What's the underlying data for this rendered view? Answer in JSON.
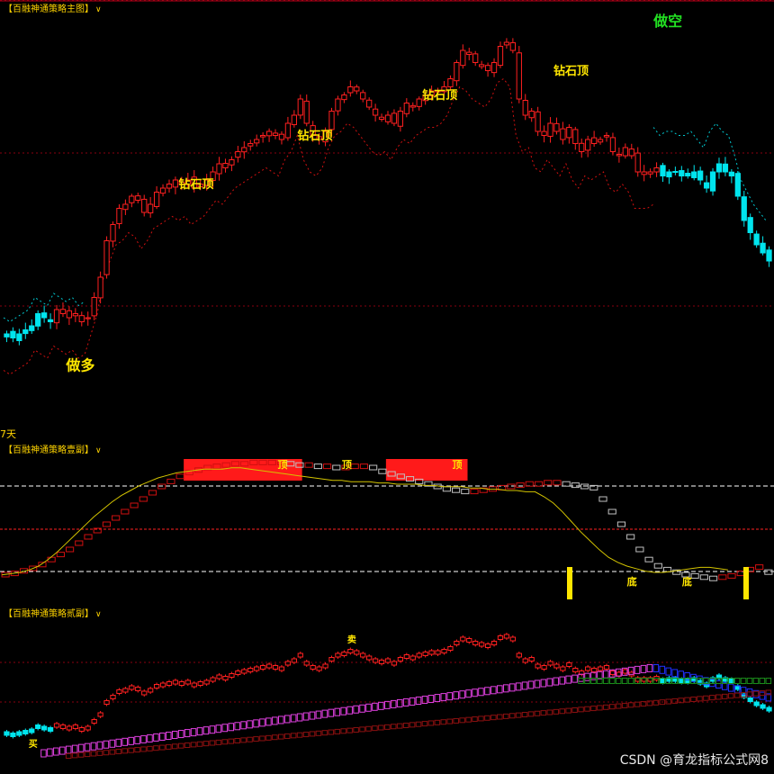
{
  "panels": {
    "main": {
      "title": "【百融神通策略主图】"
    },
    "sub1": {
      "title": "【百融神通策略壹副】"
    },
    "sub2": {
      "title": "【百融神通策略贰副】"
    }
  },
  "main_days_label": "7天",
  "watermark": "CSDN @育龙指标公式网8",
  "colors": {
    "up": "#ff2020",
    "down": "#00e5ee",
    "label_yellow": "#ffe600",
    "label_green": "#22e022",
    "stop_red": "#d01010",
    "stop_cyan": "#00c8d0"
  },
  "chart_data": [
    {
      "type": "candlestick",
      "panel": "main",
      "ylim": [
        0,
        100
      ],
      "grid": true,
      "close": [
        22,
        21,
        22,
        23,
        24,
        27,
        26,
        25,
        28,
        27,
        26,
        27,
        25,
        26,
        31,
        36,
        45,
        49,
        53,
        54,
        56,
        55,
        52,
        54,
        57,
        58,
        59,
        60,
        59,
        60,
        58,
        59,
        60,
        62,
        64,
        63,
        65,
        67,
        68,
        69,
        70,
        71,
        72,
        71,
        70,
        74,
        76,
        80,
        74,
        71,
        70,
        72,
        77,
        80,
        81,
        83,
        82,
        80,
        78,
        76,
        75,
        76,
        74,
        77,
        79,
        78,
        80,
        81,
        82,
        82,
        83,
        85,
        89,
        92,
        91,
        89,
        88,
        87,
        89,
        93,
        94,
        92,
        80,
        76,
        77,
        72,
        71,
        74,
        72,
        70,
        73,
        69,
        67,
        70,
        69,
        70,
        71,
        67,
        66,
        68,
        66,
        62,
        62,
        62,
        63,
        61,
        62,
        62,
        61,
        61,
        62,
        60,
        58,
        62,
        64,
        62,
        61,
        56,
        50,
        47,
        44,
        42,
        40
      ],
      "annotations": [
        {
          "text": "做多",
          "index": 10,
          "value": 13,
          "color": "label_yellow"
        },
        {
          "text": "钻石顶",
          "index": 28,
          "value": 58,
          "color": "label_yellow"
        },
        {
          "text": "钻石顶",
          "index": 47,
          "value": 70,
          "color": "label_yellow"
        },
        {
          "text": "钻石顶",
          "index": 67,
          "value": 80,
          "color": "label_yellow"
        },
        {
          "text": "钻石顶",
          "index": 88,
          "value": 86,
          "color": "label_yellow"
        },
        {
          "text": "做空",
          "index": 104,
          "value": 98,
          "color": "label_green"
        }
      ]
    },
    {
      "type": "line",
      "panel": "sub1",
      "ylim": [
        0,
        100
      ],
      "series": [
        {
          "values": [
            10,
            11,
            13,
            15,
            18,
            22,
            26,
            30,
            35,
            40,
            45,
            50,
            55,
            60,
            65,
            70,
            75,
            80,
            84,
            88,
            91,
            93,
            95,
            96,
            97,
            98,
            98,
            99,
            99,
            99,
            99,
            98,
            97,
            97,
            96,
            96,
            95,
            95,
            96,
            96,
            95,
            92,
            90,
            88,
            86,
            84,
            82,
            80,
            78,
            77,
            76,
            76,
            77,
            78,
            79,
            80,
            81,
            82,
            82,
            83,
            83,
            82,
            81,
            80,
            79,
            70,
            60,
            50,
            40,
            30,
            22,
            17,
            14,
            12,
            10,
            9,
            8,
            7,
            8,
            9,
            11,
            14,
            16,
            12
          ]
        },
        {
          "values": [
            8,
            9,
            10,
            12,
            15,
            20,
            26,
            33,
            40,
            47,
            54,
            60,
            66,
            71,
            75,
            79,
            82,
            85,
            87,
            89,
            90,
            91,
            92,
            92,
            92,
            93,
            93,
            92,
            91,
            90,
            89,
            88,
            87,
            86,
            85,
            84,
            83,
            83,
            82,
            82,
            82,
            81,
            81,
            80,
            80,
            80,
            79,
            79,
            78,
            78,
            78,
            77,
            77,
            76,
            76,
            75,
            75,
            74,
            74,
            70,
            65,
            58,
            50,
            42,
            35,
            28,
            22,
            18,
            15,
            13,
            11,
            10,
            10,
            11,
            12,
            13,
            14,
            14,
            13,
            12
          ]
        }
      ],
      "markers": [
        {
          "text": "顶",
          "index": 30
        },
        {
          "text": "顶",
          "index": 37
        },
        {
          "text": "顶",
          "index": 49
        },
        {
          "text": "底",
          "index": 68
        },
        {
          "text": "底",
          "index": 74
        }
      ]
    },
    {
      "type": "candlestick",
      "panel": "sub2",
      "ylim": [
        0,
        100
      ],
      "markers": [
        {
          "text": "买",
          "index": 4
        },
        {
          "text": "卖",
          "index": 55
        }
      ]
    }
  ]
}
